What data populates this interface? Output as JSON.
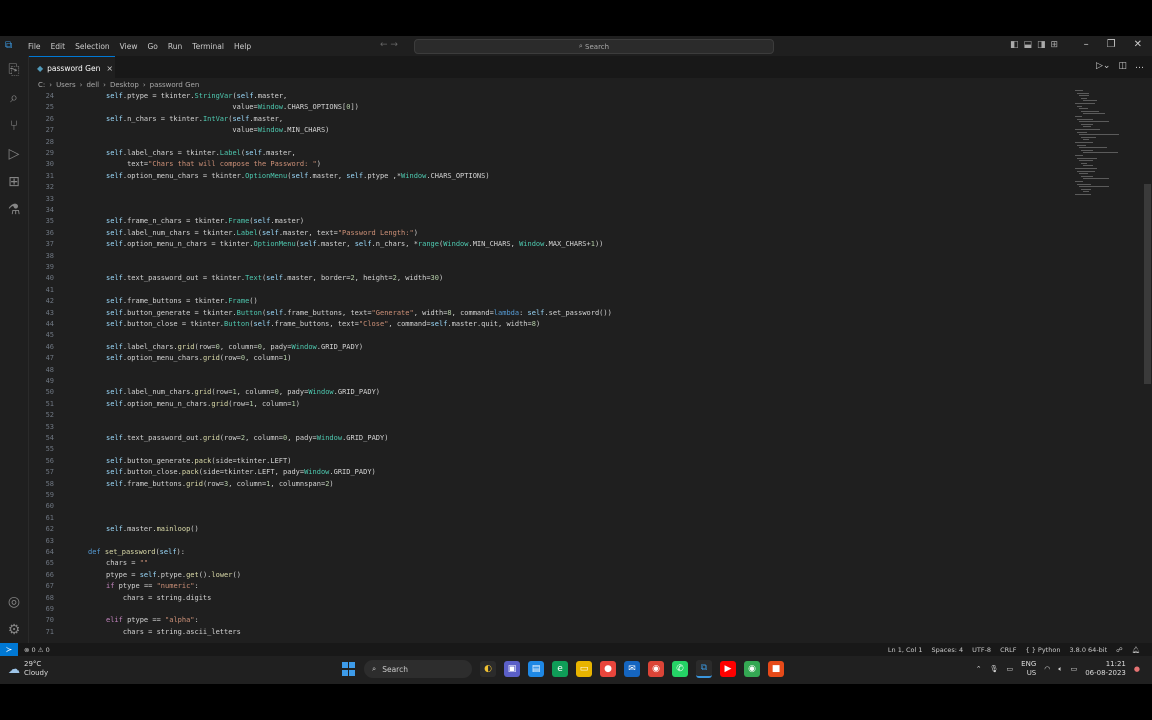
{
  "menu": [
    "File",
    "Edit",
    "Selection",
    "View",
    "Go",
    "Run",
    "Terminal",
    "Help"
  ],
  "search_label": "Search",
  "tab": {
    "label": "password Gen",
    "close": "×"
  },
  "breadcrumb": [
    "C:",
    "Users",
    "dell",
    "Desktop",
    "password Gen"
  ],
  "code_lines": [
    {
      "n": "24",
      "html": "<span class='v'>self</span>.ptype = tkinter.<span class='c'>StringVar</span>(<span class='v'>self</span>.master,"
    },
    {
      "n": "25",
      "html": "                              value=<span class='c'>Window</span>.CHARS_OPTIONS[<span class='n'>0</span>])"
    },
    {
      "n": "26",
      "html": "<span class='v'>self</span>.n_chars = tkinter.<span class='c'>IntVar</span>(<span class='v'>self</span>.master,"
    },
    {
      "n": "27",
      "html": "                              value=<span class='c'>Window</span>.MIN_CHARS)"
    },
    {
      "n": "28",
      "html": ""
    },
    {
      "n": "29",
      "html": "<span class='v'>self</span>.label_chars = tkinter.<span class='c'>Label</span>(<span class='v'>self</span>.master,"
    },
    {
      "n": "30",
      "html": "     text=<span class='s'>\"Chars that will compose the Password: \"</span>)"
    },
    {
      "n": "31",
      "html": "<span class='v'>self</span>.option_menu_chars = tkinter.<span class='c'>OptionMenu</span>(<span class='v'>self</span>.master, <span class='v'>self</span>.ptype ,*<span class='c'>Window</span>.CHARS_OPTIONS)"
    },
    {
      "n": "32",
      "html": ""
    },
    {
      "n": "33",
      "html": ""
    },
    {
      "n": "34",
      "html": ""
    },
    {
      "n": "35",
      "html": "<span class='v'>self</span>.frame_n_chars = tkinter.<span class='c'>Frame</span>(<span class='v'>self</span>.master)"
    },
    {
      "n": "36",
      "html": "<span class='v'>self</span>.label_num_chars = tkinter.<span class='c'>Label</span>(<span class='v'>self</span>.master, text=<span class='s'>\"Password Length:\"</span>)"
    },
    {
      "n": "37",
      "html": "<span class='v'>self</span>.option_menu_n_chars = tkinter.<span class='c'>OptionMenu</span>(<span class='v'>self</span>.master, <span class='v'>self</span>.n_chars, *<span class='c'>range</span>(<span class='c'>Window</span>.MIN_CHARS, <span class='c'>Window</span>.MAX_CHARS+<span class='n'>1</span>))"
    },
    {
      "n": "38",
      "html": ""
    },
    {
      "n": "39",
      "html": ""
    },
    {
      "n": "40",
      "html": "<span class='v'>self</span>.text_password_out = tkinter.<span class='c'>Text</span>(<span class='v'>self</span>.master, border=<span class='n'>2</span>, height=<span class='n'>2</span>, width=<span class='n'>30</span>)"
    },
    {
      "n": "41",
      "html": ""
    },
    {
      "n": "42",
      "html": "<span class='v'>self</span>.frame_buttons = tkinter.<span class='c'>Frame</span>()"
    },
    {
      "n": "43",
      "html": "<span class='v'>self</span>.button_generate = tkinter.<span class='c'>Button</span>(<span class='v'>self</span>.frame_buttons, text=<span class='s'>\"Generate\"</span>, width=<span class='n'>8</span>, command=<span class='b'>lambda</span>: <span class='v'>self</span>.set_password())"
    },
    {
      "n": "44",
      "html": "<span class='v'>self</span>.button_close = tkinter.<span class='c'>Button</span>(<span class='v'>self</span>.frame_buttons, text=<span class='s'>\"Close\"</span>, command=<span class='v'>self</span>.master.quit, width=<span class='n'>8</span>)"
    },
    {
      "n": "45",
      "html": ""
    },
    {
      "n": "46",
      "html": "<span class='v'>self</span>.label_chars.<span class='f'>grid</span>(row=<span class='n'>0</span>, column=<span class='n'>0</span>, pady=<span class='c'>Window</span>.GRID_PADY)"
    },
    {
      "n": "47",
      "html": "<span class='v'>self</span>.option_menu_chars.<span class='f'>grid</span>(row=<span class='n'>0</span>, column=<span class='n'>1</span>)"
    },
    {
      "n": "48",
      "html": ""
    },
    {
      "n": "49",
      "html": ""
    },
    {
      "n": "50",
      "html": "<span class='v'>self</span>.label_num_chars.<span class='f'>grid</span>(row=<span class='n'>1</span>, column=<span class='n'>0</span>, pady=<span class='c'>Window</span>.GRID_PADY)"
    },
    {
      "n": "51",
      "html": "<span class='v'>self</span>.option_menu_n_chars.<span class='f'>grid</span>(row=<span class='n'>1</span>, column=<span class='n'>1</span>)"
    },
    {
      "n": "52",
      "html": ""
    },
    {
      "n": "53",
      "html": ""
    },
    {
      "n": "54",
      "html": "<span class='v'>self</span>.text_password_out.<span class='f'>grid</span>(row=<span class='n'>2</span>, column=<span class='n'>0</span>, pady=<span class='c'>Window</span>.GRID_PADY)"
    },
    {
      "n": "55",
      "html": ""
    },
    {
      "n": "56",
      "html": "<span class='v'>self</span>.button_generate.<span class='f'>pack</span>(side=tkinter.LEFT)"
    },
    {
      "n": "57",
      "html": "<span class='v'>self</span>.button_close.<span class='f'>pack</span>(side=tkinter.LEFT, pady=<span class='c'>Window</span>.GRID_PADY)"
    },
    {
      "n": "58",
      "html": "<span class='v'>self</span>.frame_buttons.<span class='f'>grid</span>(row=<span class='n'>3</span>, column=<span class='n'>1</span>, columnspan=<span class='n'>2</span>)"
    },
    {
      "n": "59",
      "html": ""
    },
    {
      "n": "60",
      "html": ""
    },
    {
      "n": "61",
      "html": ""
    },
    {
      "n": "62",
      "html": "<span class='v'>self</span>.master.<span class='f'>mainloop</span>()"
    },
    {
      "n": "63",
      "html": ""
    },
    {
      "n": "64",
      "html": "<span class='b'>def</span> <span class='f'>set_password</span>(<span class='v'>self</span>):"
    },
    {
      "n": "65",
      "html": "chars = <span class='s'>\"\"</span>"
    },
    {
      "n": "66",
      "html": "ptype = <span class='v'>self</span>.ptype.<span class='f'>get</span>().<span class='f'>lower</span>()"
    },
    {
      "n": "67",
      "html": "<span class='k'>if</span> ptype == <span class='s'>\"numeric\"</span>:"
    },
    {
      "n": "68",
      "html": "    chars = string.digits"
    },
    {
      "n": "69",
      "html": ""
    },
    {
      "n": "70",
      "html": "<span class='k'>elif</span> ptype == <span class='s'>\"alpha\"</span>:"
    },
    {
      "n": "71",
      "html": "    chars = string.ascii_letters"
    }
  ],
  "status": {
    "problems": "⊗ 0 ⚠ 0",
    "cursor": "Ln 1, Col 1",
    "spaces": "Spaces: 4",
    "encoding": "UTF-8",
    "eol": "CRLF",
    "language": "Python",
    "interpreter": "3.8.0 64-bit"
  },
  "weather": {
    "temp": "29°C",
    "desc": "Cloudy"
  },
  "taskbar_search": "Search",
  "tray": {
    "lang1": "ENG",
    "lang2": "US",
    "time": "11:21",
    "date": "06-08-2023"
  }
}
